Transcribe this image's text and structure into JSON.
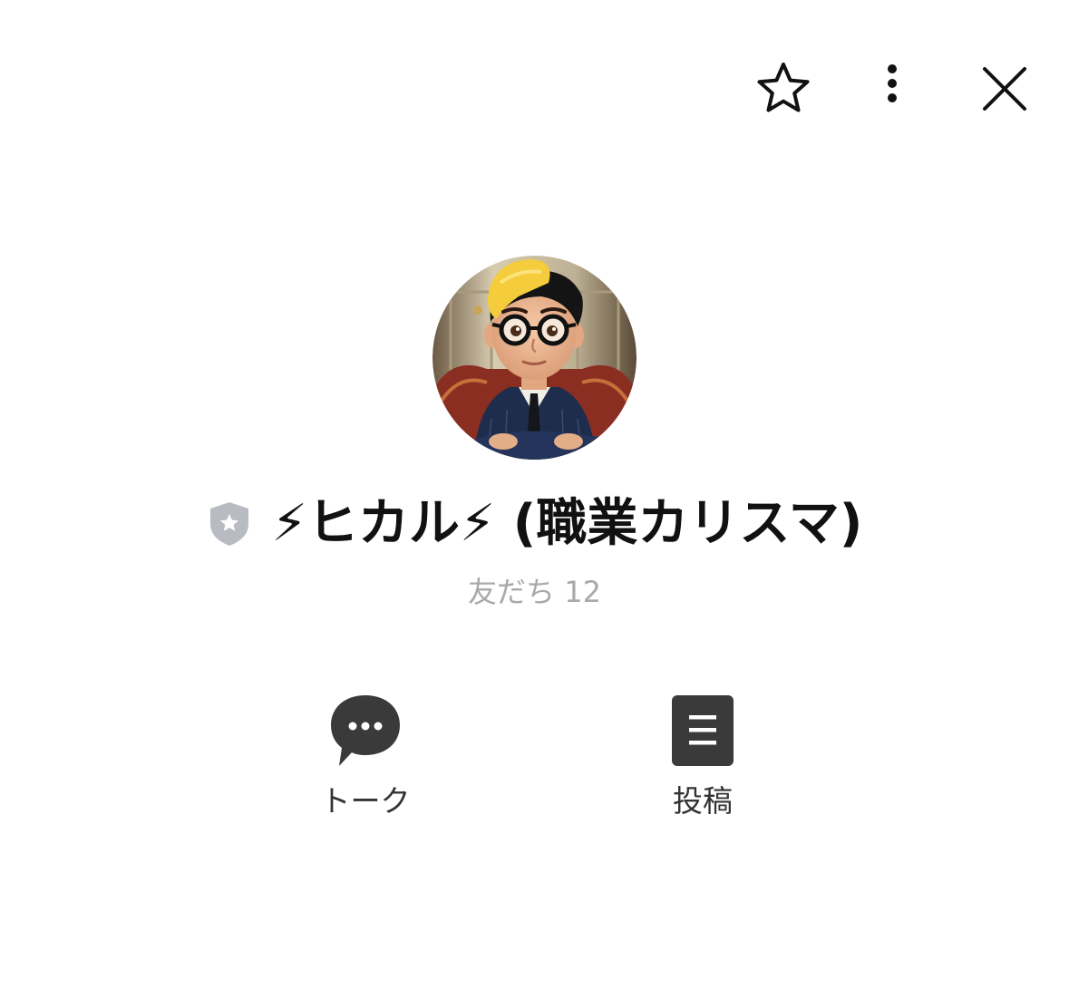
{
  "header": {
    "icons": [
      "star-icon",
      "more-vertical-icon",
      "close-icon"
    ]
  },
  "profile": {
    "name": "⚡ヒカル⚡ (職業カリスマ)",
    "friends_label": "友だち",
    "friends_count": "12",
    "badge_icon": "shield-star-icon",
    "avatar": "cartoon-avatar"
  },
  "actions": {
    "talk_label": "トーク",
    "talk_icon": "chat-bubble-icon",
    "posts_label": "投稿",
    "posts_icon": "posts-list-icon"
  },
  "colors": {
    "text_primary": "#111111",
    "text_secondary": "#a9a9a9",
    "icon_dark": "#3a3a3a",
    "badge_gray": "#b8bcc2"
  }
}
